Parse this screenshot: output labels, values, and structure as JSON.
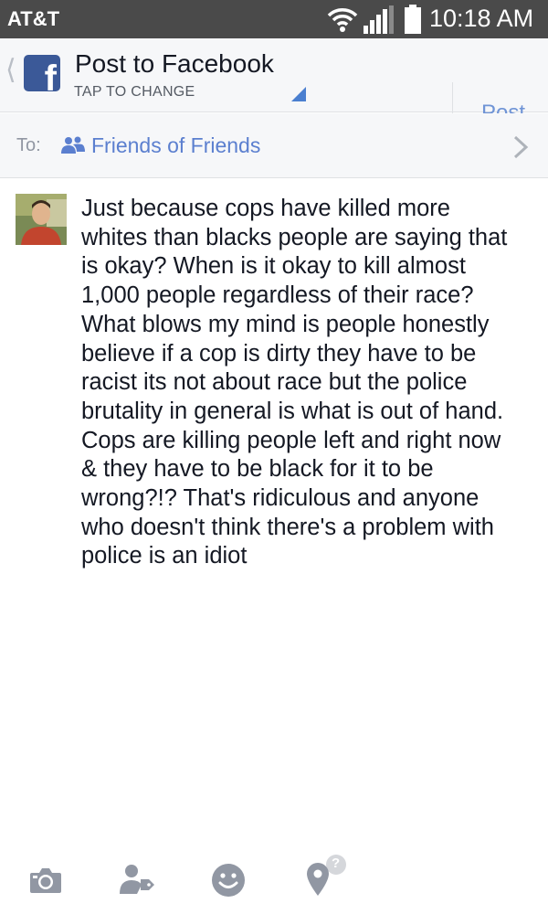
{
  "status_bar": {
    "carrier": "AT&T",
    "time": "10:18 AM",
    "icons": [
      "wifi-icon",
      "signal-icon",
      "battery-icon"
    ]
  },
  "header": {
    "title": "Post to Facebook",
    "subtitle": "TAP TO CHANGE",
    "post_label": "Post",
    "icons": [
      "back-chevron-icon",
      "facebook-logo",
      "dropdown-corner-icon"
    ]
  },
  "audience": {
    "to_label": "To:",
    "value": "Friends of Friends",
    "icons": [
      "friends-icon",
      "chevron-right-icon"
    ]
  },
  "composer": {
    "text": "Just because cops have killed more\nwhites than blacks people are saying that\nis okay? When is it okay to kill almost\n1,000 people regardless of their race?\nWhat blows my mind is people honestly\nbelieve if a cop is dirty they have to be\nracist its not about race but the police\nbrutality in general is what is out of hand.\nCops are killing people left and right now\n& they have to be black for it to be\nwrong?!? That's ridiculous and anyone\nwho doesn't think there's a problem with\npolice is an idiot"
  },
  "toolbar": {
    "icons": [
      "camera-icon",
      "tag-person-icon",
      "smiley-icon",
      "location-pin-icon"
    ],
    "location_badge": "?"
  },
  "colors": {
    "status_bar": "#4a4a4a",
    "header_bg": "#f6f7f9",
    "facebook_blue": "#3b5998",
    "link_blue": "#5b7fcf",
    "post_button": "#6f94d6",
    "text": "#141823",
    "muted": "#9197a3",
    "toolbar_icon": "#9197a3"
  }
}
